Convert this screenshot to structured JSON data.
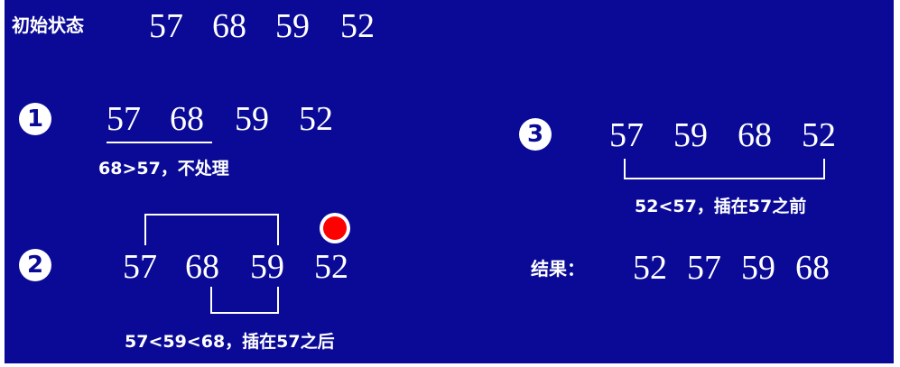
{
  "initial": {
    "label": "初始状态",
    "values": [
      "57",
      "68",
      "59",
      "52"
    ]
  },
  "steps": [
    {
      "marker": "1",
      "values": [
        "57",
        "68",
        "59",
        "52"
      ],
      "note": "68>57，不处理"
    },
    {
      "marker": "2",
      "values": [
        "57",
        "68",
        "59",
        "52"
      ],
      "note": "57<59<68，插在57之后"
    },
    {
      "marker": "3",
      "values": [
        "57",
        "59",
        "68",
        "52"
      ],
      "note": "52<57，插在57之前"
    }
  ],
  "result": {
    "label": "结果：",
    "values": [
      "52",
      "57",
      "59",
      "68"
    ]
  },
  "colors": {
    "background": "#0a0a96",
    "text": "#ffffff",
    "marker": "#ff0000"
  }
}
